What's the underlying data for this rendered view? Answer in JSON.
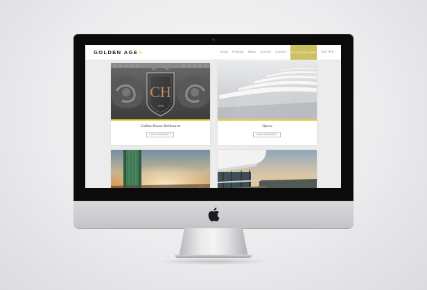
{
  "site": {
    "logo_text": "GOLDEN AGE",
    "logo_mark": ">"
  },
  "nav": {
    "links": [
      "About",
      "Projects",
      "News",
      "Careers",
      "Contact"
    ],
    "register_label": "Register Now",
    "language": "EN / 中文"
  },
  "projects": [
    {
      "title": "Collins House Melbourne",
      "button": "View Project",
      "emblem": "CH",
      "emblem_year": "1908"
    },
    {
      "title": "Opera",
      "button": "View Project"
    },
    {
      "title": "",
      "button": ""
    },
    {
      "title": "",
      "button": ""
    }
  ],
  "colors": {
    "accent": "#e8cf3b",
    "register_bg": "#cbbf5e",
    "bezel": "#0b0b0c",
    "aluminium": "#d0d0d3"
  },
  "icons": [
    "apple-logo-icon",
    "arrow-icon"
  ]
}
